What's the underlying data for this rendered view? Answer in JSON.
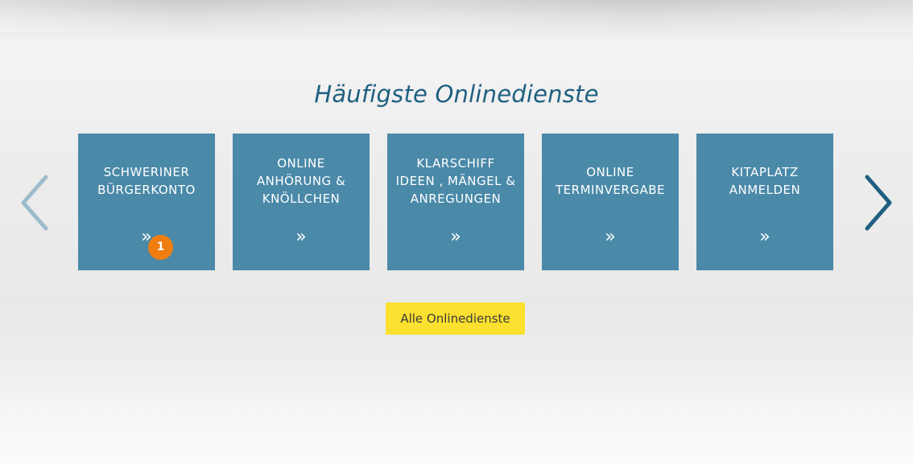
{
  "section": {
    "heading": "Häufigste Onlinedienste"
  },
  "carousel": {
    "prev_icon": "chevron-left-icon",
    "next_icon": "chevron-right-icon",
    "chevron_glyph": "»",
    "tiles": [
      {
        "lines": [
          "SCHWERINER",
          "BÜRGERKONTO"
        ],
        "badge": "1"
      },
      {
        "lines": [
          "ONLINE",
          "ANHÖRUNG &",
          "KNÖLLCHEN"
        ]
      },
      {
        "lines": [
          "KLARSCHIFF",
          "IDEEN , MÄNGEL &",
          "ANREGUNGEN"
        ]
      },
      {
        "lines": [
          "ONLINE",
          "TERMINVERGABE"
        ]
      },
      {
        "lines": [
          "KITAPLATZ",
          "ANMELDEN"
        ]
      }
    ]
  },
  "all_services": {
    "label": "Alle Onlinedienste"
  },
  "colors": {
    "tile_bg": "#4a89a8",
    "heading": "#1f5f80",
    "button_bg": "#fbe02f",
    "badge_bg": "#f07d10",
    "arrow_prev": "#9dbccb",
    "arrow_next": "#1f5f80"
  }
}
